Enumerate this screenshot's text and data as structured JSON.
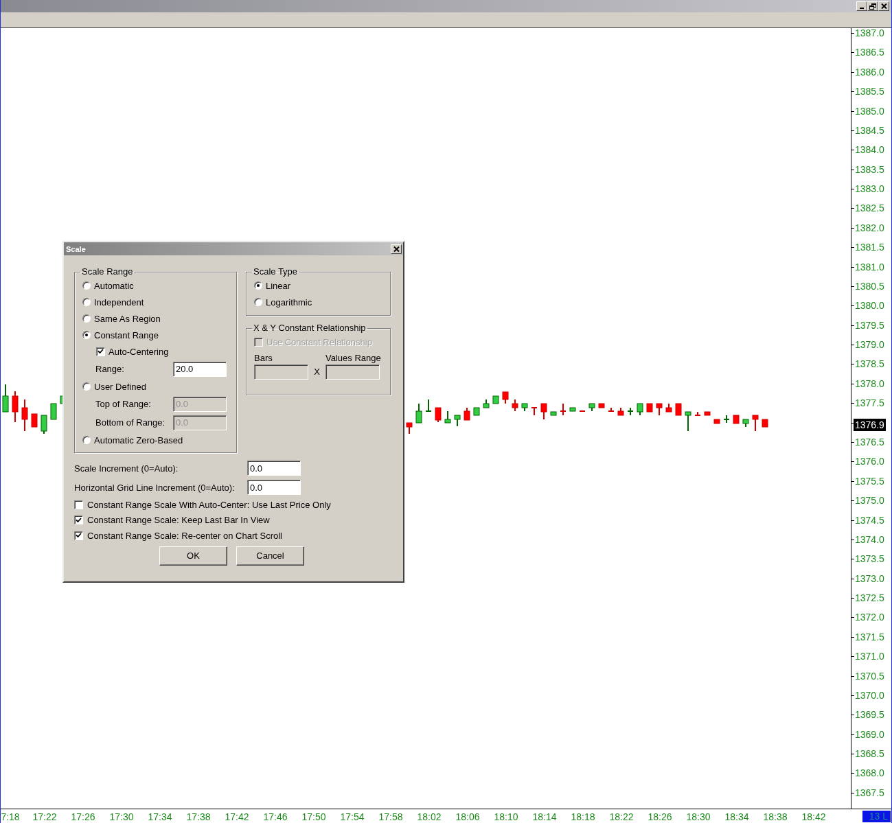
{
  "chart": {
    "price_labels": [
      "1387.0",
      "1386.5",
      "1386.0",
      "1385.5",
      "1385.0",
      "1384.5",
      "1384.0",
      "1383.5",
      "1383.0",
      "1382.5",
      "1382.0",
      "1381.5",
      "1381.0",
      "1380.5",
      "1380.0",
      "1379.5",
      "1379.0",
      "1378.5",
      "1378.0",
      "1377.5"
    ],
    "price_labels_below": [
      "1376.5",
      "1376.0",
      "1375.5",
      "1375.0",
      "1374.5",
      "1374.0",
      "1373.5",
      "1373.0",
      "1372.5",
      "1372.0",
      "1371.5",
      "1371.0",
      "1370.5",
      "1370.0",
      "1369.5",
      "1369.0",
      "1368.5",
      "1368.0",
      "1367.5"
    ],
    "time_labels": [
      "7:18",
      "17:22",
      "17:26",
      "17:30",
      "17:34",
      "17:38",
      "17:42",
      "17:46",
      "17:50",
      "17:54",
      "17:58",
      "18:02",
      "18:06",
      "18:10",
      "18:14",
      "18:18",
      "18:22",
      "18:26",
      "18:30",
      "18:34",
      "18:38",
      "18:42"
    ],
    "last_price": "1376.9",
    "status_badge": "13 L"
  },
  "dialog": {
    "title": "Scale",
    "scale_range": {
      "label": "Scale Range",
      "items": [
        {
          "kind": "radio",
          "label": "Automatic",
          "selected": false
        },
        {
          "kind": "radio",
          "label": "Independent",
          "selected": false
        },
        {
          "kind": "radio",
          "label": "Same As Region",
          "selected": false
        },
        {
          "kind": "radio",
          "label": "Constant Range",
          "selected": true
        },
        {
          "kind": "checkbox",
          "label": "Auto-Centering",
          "checked": true
        },
        {
          "kind": "field",
          "label": "Range:",
          "value": "20.0",
          "disabled": false
        },
        {
          "kind": "radio",
          "label": "User Defined",
          "selected": false
        },
        {
          "kind": "field",
          "label": "Top of Range:",
          "value": "0.0",
          "disabled": true
        },
        {
          "kind": "field",
          "label": "Bottom of Range:",
          "value": "0.0",
          "disabled": true
        },
        {
          "kind": "radio",
          "label": "Automatic Zero-Based",
          "selected": false
        }
      ]
    },
    "scale_type": {
      "label": "Scale Type",
      "options": [
        {
          "label": "Linear",
          "selected": true
        },
        {
          "label": "Logarithmic",
          "selected": false
        }
      ]
    },
    "xy_relationship": {
      "label": "X & Y Constant Relationship",
      "checkbox": {
        "label": "Use Constant Relationship",
        "checked": false,
        "disabled": true
      },
      "separator": "X",
      "fields": [
        {
          "label": "Bars",
          "disabled": true
        },
        {
          "label": "Values Range",
          "disabled": true
        }
      ]
    },
    "increments": [
      {
        "label": "Scale Increment (0=Auto):",
        "value": "0.0"
      },
      {
        "label": "Horizontal Grid Line Increment (0=Auto):",
        "value": "0.0"
      }
    ],
    "options": [
      {
        "label": "Constant Range Scale With Auto-Center: Use Last Price Only",
        "checked": false
      },
      {
        "label": "Constant Range Scale: Keep Last Bar In View",
        "checked": true
      },
      {
        "label": "Constant Range Scale: Re-center on Chart Scroll",
        "checked": true
      }
    ],
    "buttons": [
      "OK",
      "Cancel"
    ]
  }
}
